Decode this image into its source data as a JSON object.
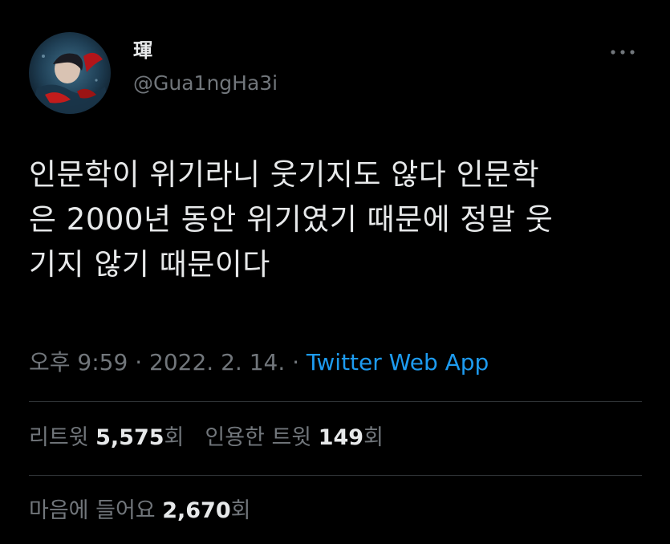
{
  "author": {
    "display_name": "琿",
    "handle": "@Gua1ngHa3i"
  },
  "more_icon": "more-horizontal-icon",
  "tweet": {
    "text": "인문학이 위기라니 웃기지도 않다 인문학\n은 2000년 동안 위기였기 때문에 정말 웃\n기지 않기 때문이다"
  },
  "meta": {
    "time": "오후 9:59",
    "sep1": " · ",
    "date": "2022. 2. 14.",
    "sep2": " · ",
    "source": "Twitter Web App"
  },
  "stats": {
    "retweets_label": "리트윗 ",
    "retweets_count": "5,575",
    "retweets_suffix": "회",
    "quotes_label": "인용한 트윗 ",
    "quotes_count": "149",
    "quotes_suffix": "회",
    "likes_label": "마음에 들어요 ",
    "likes_count": "2,670",
    "likes_suffix": "회"
  },
  "colors": {
    "background": "#000000",
    "text_primary": "#e7e9ea",
    "text_secondary": "#71767b",
    "link": "#1d9bf0",
    "divider": "#2f3336"
  }
}
